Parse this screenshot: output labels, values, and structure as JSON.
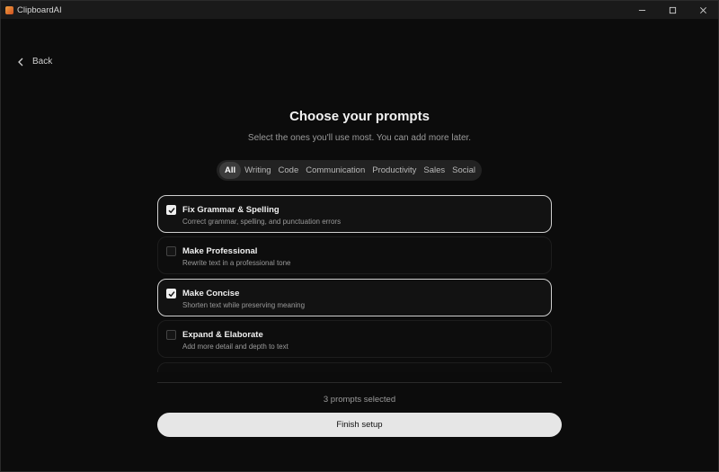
{
  "window": {
    "title": "ClipboardAI",
    "controls": [
      "minimize-icon",
      "maximize-icon",
      "close-icon"
    ]
  },
  "nav": {
    "back_label": "Back"
  },
  "header": {
    "title": "Choose your prompts",
    "subtitle": "Select the ones you'll use most. You can add more later."
  },
  "tabs": [
    {
      "label": "All",
      "active": true
    },
    {
      "label": "Writing",
      "active": false
    },
    {
      "label": "Code",
      "active": false
    },
    {
      "label": "Communication",
      "active": false
    },
    {
      "label": "Productivity",
      "active": false
    },
    {
      "label": "Sales",
      "active": false
    },
    {
      "label": "Social",
      "active": false
    }
  ],
  "prompts": [
    {
      "title": "Fix Grammar & Spelling",
      "description": "Correct grammar, spelling, and punctuation errors",
      "checked": true
    },
    {
      "title": "Make Professional",
      "description": "Rewrite text in a professional tone",
      "checked": false
    },
    {
      "title": "Make Concise",
      "description": "Shorten text while preserving meaning",
      "checked": true
    },
    {
      "title": "Expand & Elaborate",
      "description": "Add more detail and depth to text",
      "checked": false
    },
    {
      "title": "",
      "description": "",
      "checked": false
    }
  ],
  "footer": {
    "selected_count": "3 prompts selected",
    "finish_label": "Finish setup"
  },
  "colors": {
    "background": "#0c0c0c",
    "titlebar": "#1a1a1a",
    "accent_button": "#e6e6e6",
    "selected_border": "#cfcfcf"
  }
}
